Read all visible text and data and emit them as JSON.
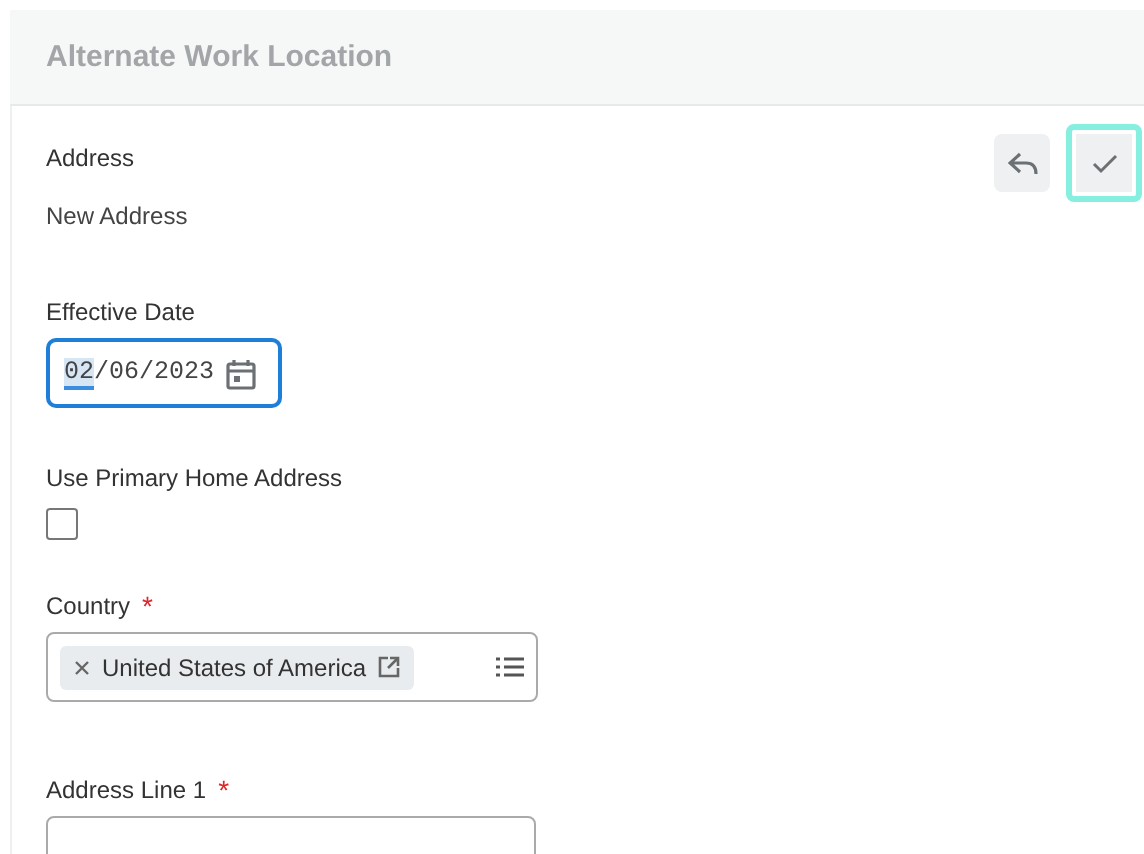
{
  "header": {
    "title": "Alternate Work Location"
  },
  "actions": [
    {
      "kind": "undo",
      "focused": false
    },
    {
      "kind": "confirm",
      "focused": true
    }
  ],
  "address": {
    "label": "Address",
    "value": "New Address"
  },
  "effective_date": {
    "label": "Effective Date",
    "focused": true,
    "segments": [
      {
        "text": "02",
        "selected": true
      },
      {
        "text": "/06/2023",
        "selected": false
      }
    ]
  },
  "use_primary": {
    "label": "Use Primary Home Address",
    "checked": false
  },
  "country": {
    "label": "Country",
    "required_mark": "*",
    "chips": [
      "United States of America"
    ]
  },
  "address_line_1": {
    "label": "Address Line 1",
    "required_mark": "*"
  }
}
